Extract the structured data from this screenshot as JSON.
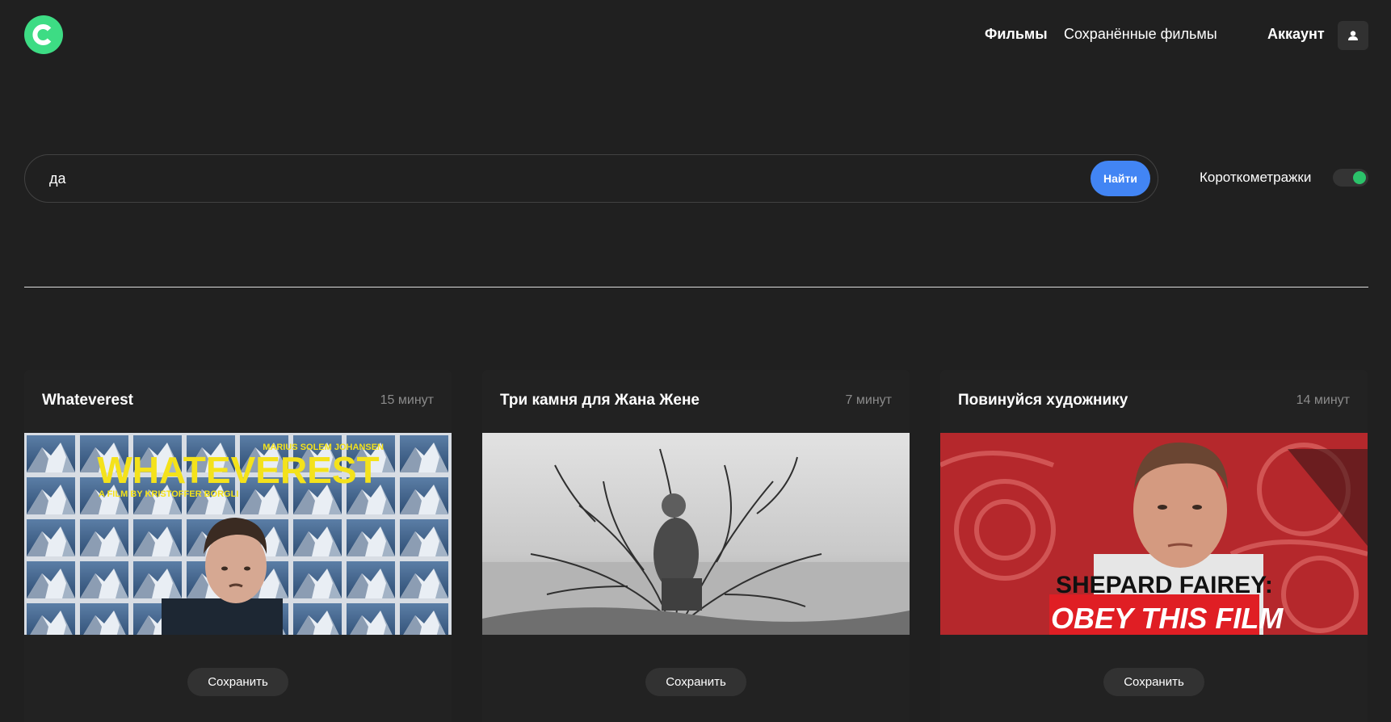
{
  "header": {
    "logo_icon": "logo-c-icon",
    "nav": {
      "movies": "Фильмы",
      "saved_movies": "Сохранённые фильмы",
      "account": "Аккаунт"
    },
    "account_icon": "user-icon"
  },
  "search": {
    "value": "да",
    "submit_label": "Найти"
  },
  "filter": {
    "shorts_label": "Короткометражки",
    "shorts_enabled": true
  },
  "movies": [
    {
      "title": "Whateverest",
      "duration": "15 минут",
      "save_label": "Сохранить",
      "poster_text": {
        "top": "MARIUS SOLEM JOHANSEN",
        "main": "WHATEVEREST",
        "sub": "A FILM BY KRISTOFFER BORGLI"
      }
    },
    {
      "title": "Три камня для Жана Жене",
      "duration": "7 минут",
      "save_label": "Сохранить"
    },
    {
      "title": "Повинуйся художнику",
      "duration": "14 минут",
      "save_label": "Сохранить",
      "poster_text": {
        "line1": "SHEPARD FAIREY:",
        "line2": "OBEY THIS FILM"
      }
    }
  ],
  "colors": {
    "background": "#202020",
    "accent_green": "#3ddc84",
    "button_blue": "#4285f4",
    "toggle_on": "#2bc26a"
  }
}
